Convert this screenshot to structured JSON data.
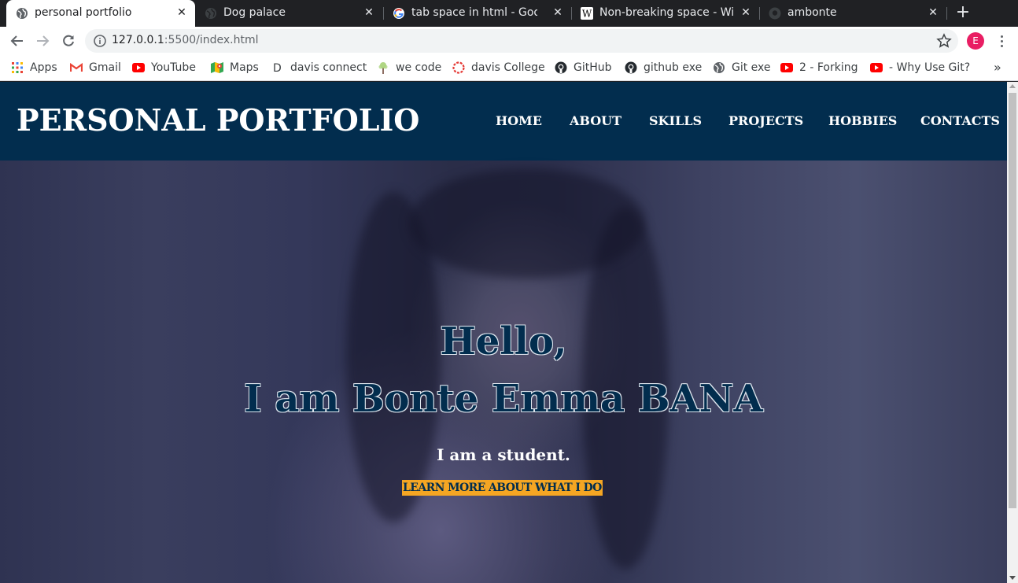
{
  "browser": {
    "tabs": [
      {
        "title": "personal portfolio",
        "icon": "globe-icon",
        "active": true
      },
      {
        "title": "Dog palace",
        "icon": "globe-icon",
        "active": false
      },
      {
        "title": "tab space in html - Google",
        "icon": "google-icon",
        "active": false
      },
      {
        "title": "Non-breaking space - Wik",
        "icon": "wikipedia-icon",
        "active": false
      },
      {
        "title": "ambonte",
        "icon": "github-icon",
        "active": false
      }
    ],
    "close_glyph": "✕",
    "new_tab_glyph": "+",
    "url_host": "127.0.0.1",
    "url_path": ":5500/index.html",
    "profile_initial": "E"
  },
  "bookmarks": [
    {
      "label": "Apps",
      "icon": "apps-grid-icon"
    },
    {
      "label": "Gmail",
      "icon": "gmail-icon"
    },
    {
      "label": "YouTube",
      "icon": "youtube-icon"
    },
    {
      "label": "Maps",
      "icon": "maps-icon"
    },
    {
      "label": "davis connect",
      "icon": "davis-d-icon"
    },
    {
      "label": "we code",
      "icon": "tree-icon"
    },
    {
      "label": "davis College",
      "icon": "davis-college-icon"
    },
    {
      "label": "GitHub",
      "icon": "github-icon"
    },
    {
      "label": "github exe",
      "icon": "github-icon"
    },
    {
      "label": "Git exe",
      "icon": "globe-icon"
    },
    {
      "label": "2 - Forking",
      "icon": "youtube-icon"
    },
    {
      "label": "- Why Use Git?",
      "icon": "youtube-icon"
    }
  ],
  "bookmarks_more": "»",
  "site": {
    "brand": "PERSONAL PORTFOLIO",
    "nav": [
      "HOME",
      "ABOUT",
      "SKILLS",
      "PROJECTS",
      "HOBBIES",
      "CONTACTS"
    ],
    "hero": {
      "greeting": "Hello,",
      "intro": "I am Bonte Emma BANA",
      "subtitle": "I am a student.",
      "cta": "LEARN MORE ABOUT WHAT I DO"
    }
  },
  "colors": {
    "header_bg": "#022d4e",
    "cta_bg": "#f5a623",
    "profile_bg": "#e91e63"
  }
}
